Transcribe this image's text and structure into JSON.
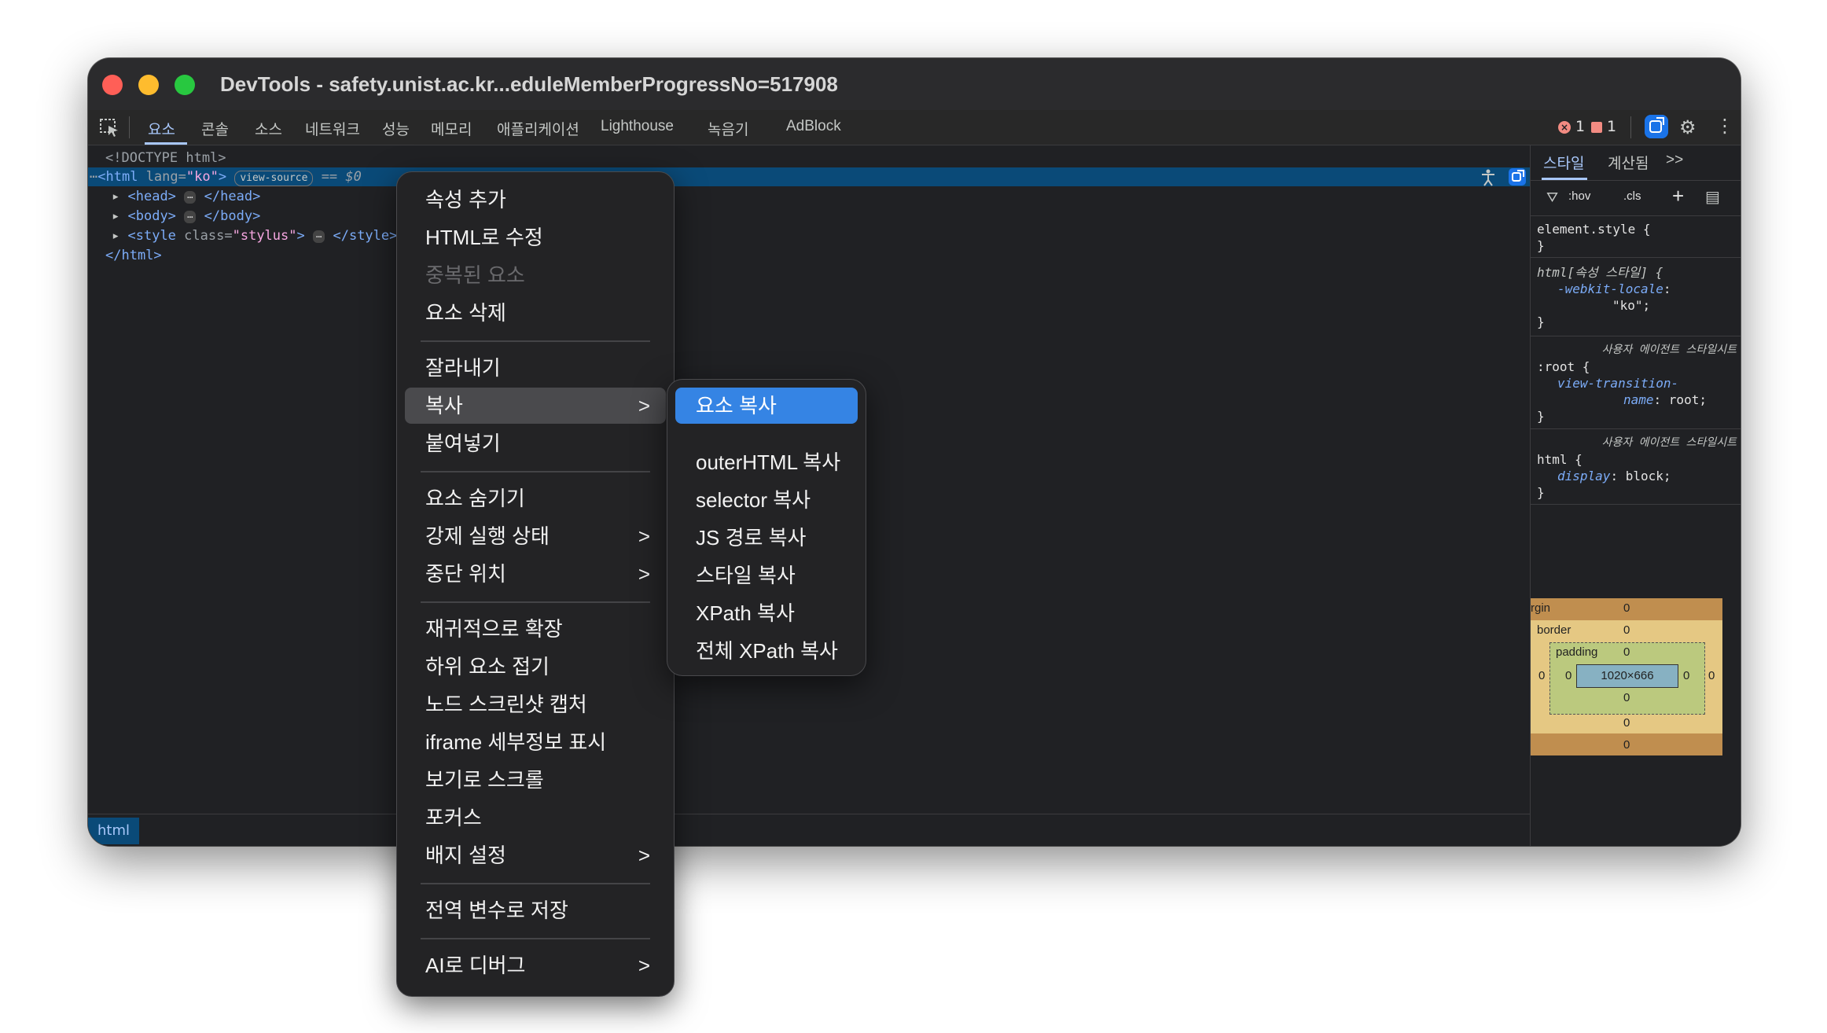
{
  "window": {
    "title": "DevTools - safety.unist.ac.kr...eduleMemberProgressNo=517908"
  },
  "toolbar": {
    "tabs": [
      "요소",
      "콘솔",
      "소스",
      "네트워크",
      "성능",
      "메모리",
      "애플리케이션",
      "Lighthouse",
      "녹음기",
      "AdBlock"
    ],
    "active_tab": "요소",
    "error_count": "1",
    "warning_count": "1",
    "icons": {
      "inspect": "inspect-icon",
      "errors": "error-icon",
      "warnings": "warning-flag-icon",
      "extension": "extension-icon",
      "settings": "gear-icon",
      "more": "kebab-icon"
    }
  },
  "dom_tree": {
    "doctype": "<!DOCTYPE html>",
    "html_open": "<html",
    "lang_attr": "lang",
    "lang_value": "\"ko\"",
    "html_close_bracket": ">",
    "view_source_badge": "view-source",
    "selected_marker": "== $0",
    "head": "<head>",
    "head_close": "</head>",
    "body": "<body>",
    "body_close": "</body>",
    "style_open": "<style",
    "class_attr": "class",
    "class_value": "\"stylus\"",
    "style_close": "</style>",
    "html_end": "</html>",
    "ellipsis": "⋯"
  },
  "breadcrumb": {
    "items": [
      "html"
    ]
  },
  "styles_pane": {
    "tabs": [
      "스타일",
      "계산됨"
    ],
    "more": ">>",
    "filter": {
      "hov": ":hov",
      "cls": ".cls",
      "add": "+"
    },
    "rules": {
      "element_style": "element.style {",
      "close": "}",
      "html_attr_selector": "html[속성 스타일] {",
      "webkit_locale_prop": "-webkit-locale",
      "webkit_locale_value": "\"ko\";",
      "ua_label": "사용자 에이전트 스타일시트",
      "root_selector": ":root {",
      "vt_prop_1": "view-transition-",
      "vt_prop_2": "name",
      "vt_value": "root;",
      "html_selector": "html {",
      "display_prop": "display",
      "display_value": "block;"
    },
    "box_model": {
      "margin_label": "rgin",
      "border_label": "border",
      "padding_label": "padding",
      "content": "1020×666",
      "zero": "0"
    }
  },
  "context_menu": {
    "items": [
      {
        "label": "속성 추가"
      },
      {
        "label": "HTML로 수정"
      },
      {
        "label": "중복된 요소"
      },
      {
        "label": "요소 삭제"
      },
      {
        "label": "잘라내기"
      },
      {
        "label": "복사"
      },
      {
        "label": "붙여넣기"
      },
      {
        "label": "요소 숨기기"
      },
      {
        "label": "강제 실행 상태"
      },
      {
        "label": "중단 위치"
      },
      {
        "label": "재귀적으로 확장"
      },
      {
        "label": "하위 요소 접기"
      },
      {
        "label": "노드 스크린샷 캡처"
      },
      {
        "label": "iframe 세부정보 표시"
      },
      {
        "label": "보기로 스크롤"
      },
      {
        "label": "포커스"
      },
      {
        "label": "배지 설정"
      },
      {
        "label": "전역 변수로 저장"
      },
      {
        "label": "AI로 디버그"
      }
    ],
    "submenu_chevron": ">"
  },
  "copy_submenu": {
    "items": [
      {
        "label": "요소 복사"
      },
      {
        "label": "outerHTML 복사"
      },
      {
        "label": "selector 복사"
      },
      {
        "label": "JS 경로 복사"
      },
      {
        "label": "스타일 복사"
      },
      {
        "label": "XPath 복사"
      },
      {
        "label": "전체 XPath 복사"
      }
    ]
  },
  "colors": {
    "accent": "#3584e4",
    "selected_row": "#0a4a78",
    "tag": "#7cacf8",
    "attr_value": "#f6a7e1"
  }
}
